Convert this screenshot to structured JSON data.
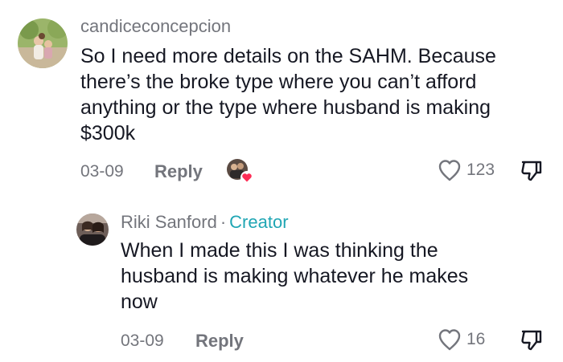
{
  "comment": {
    "username": "candiceconcepcion",
    "text": "So I need more details on the SAHM. Because there’s the broke type where you can’t afford anything or the type where husband is making $300k",
    "date": "03-09",
    "reply_label": "Reply",
    "like_count": "123"
  },
  "reply": {
    "username": "Riki Sanford",
    "separator": "·",
    "badge": "Creator",
    "text": "When I made this I was thinking the husband is making whatever he makes now",
    "date": "03-09",
    "reply_label": "Reply",
    "like_count": "16"
  },
  "colors": {
    "secondary_text": "#73757c",
    "creator_badge": "#20a6b4",
    "heart_badge": "#fe2c55"
  },
  "icons": {
    "like": "heart-outline-icon",
    "dislike": "thumbs-down-icon",
    "creator_liked": "creator-liked-heart-icon"
  }
}
